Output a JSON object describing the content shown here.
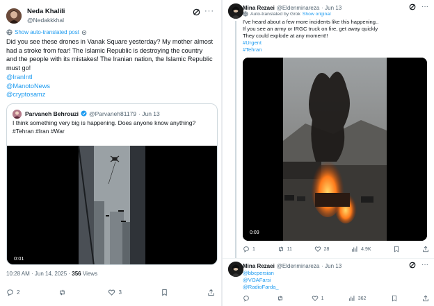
{
  "left_tweet": {
    "author_name": "Neda Khalili",
    "author_handle": "@Nedakkkhal",
    "grok_icon": "grok-icon",
    "more_label": "···",
    "translated_label": "Show auto-translated post",
    "body": "Did you see these drones in Vanak Square yesterday? My mother almost had a stroke from fear! The Islamic Republic is destroying the country and the people with its mistakes! The Iranian nation, the Islamic Republic must go!",
    "mentions": [
      "@IranIntl",
      "@ManotoNews",
      "@cryptosamz"
    ],
    "quote": {
      "author_name": "Parvaneh Behrouzi",
      "author_handle": "@Parvaneh81179",
      "date": "· Jun 13",
      "text": "I think something very big is happening. Does anyone know anything?",
      "hashtags": "#Tehran #Iran #War",
      "video_time": "0:01"
    },
    "meta_time": "10:28 AM · Jun 14, 2025 · ",
    "meta_views_count": "356",
    "meta_views_label": " Views",
    "actions": {
      "replies": "2",
      "retweets": "",
      "likes": "3"
    }
  },
  "right_tweet": {
    "author_name": "Mina Rezaei",
    "author_handle": "@Eldenminareza",
    "date": "· Jun 13",
    "translated_label": "Auto-translated by Grok",
    "show_original": "Show original",
    "body_lines": [
      "I've heard about a few more incidents like this happening..",
      "If you see an army or IRGC truck on fire, get away quickly",
      "They could explode at any moment!!"
    ],
    "hashtags": [
      "#Urgent",
      "#Tehran"
    ],
    "video_time": "0:09",
    "actions": {
      "replies": "1",
      "retweets": "11",
      "likes": "28",
      "views": "4.9K"
    }
  },
  "reply_tweet": {
    "author_name": "Mina Rezaei",
    "author_handle": "@Eldenminareza",
    "date": "· Jun 13",
    "mentions": [
      "@bbcpersian",
      "@VOAFarsi",
      "@RadioFarda_"
    ],
    "actions": {
      "replies": "",
      "retweets": "",
      "likes": "1",
      "views": "362"
    }
  },
  "colors": {
    "link": "#1d9bf0",
    "muted": "#536471",
    "text": "#0f1419"
  }
}
